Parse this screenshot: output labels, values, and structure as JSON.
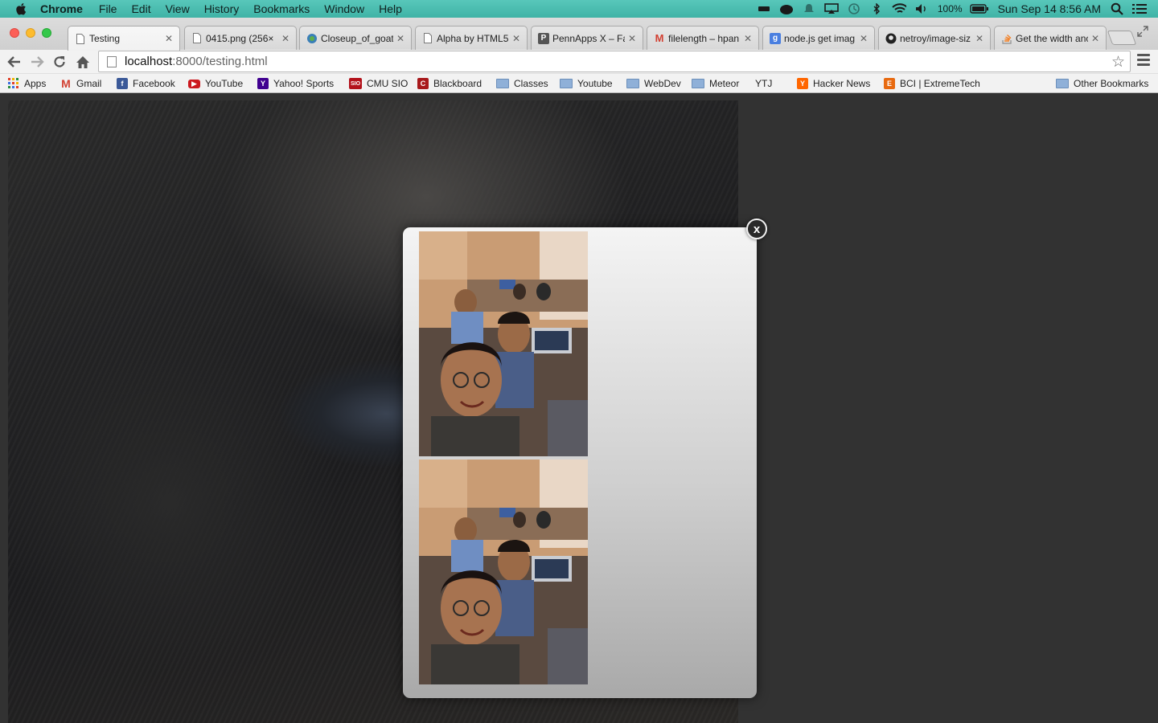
{
  "menubar": {
    "app": "Chrome",
    "items": [
      "File",
      "Edit",
      "View",
      "History",
      "Bookmarks",
      "Window",
      "Help"
    ],
    "battery": "100%",
    "datetime": "Sun Sep 14  8:56 AM"
  },
  "tabs": [
    {
      "title": "Testing",
      "favicon": "page-icon",
      "active": true
    },
    {
      "title": "0415.png (256×",
      "favicon": "page-icon"
    },
    {
      "title": "Closeup_of_goat",
      "favicon": "wikimedia-icon"
    },
    {
      "title": "Alpha by HTML5",
      "favicon": "page-icon"
    },
    {
      "title": "PennApps X – Fa",
      "favicon": "pennapps-icon"
    },
    {
      "title": "filelength – hpan",
      "favicon": "gmail-icon"
    },
    {
      "title": "node.js get imag",
      "favicon": "google-icon"
    },
    {
      "title": "netroy/image-siz",
      "favicon": "github-icon"
    },
    {
      "title": "Get the width anc",
      "favicon": "stackoverflow-icon"
    }
  ],
  "address": {
    "host": "localhost",
    "path": ":8000/testing.html"
  },
  "bookmarks": [
    {
      "label": "Apps",
      "icon": "apps-grid-icon"
    },
    {
      "label": "Gmail",
      "icon": "gmail-icon"
    },
    {
      "label": "Facebook",
      "icon": "facebook-icon"
    },
    {
      "label": "YouTube",
      "icon": "youtube-icon"
    },
    {
      "label": "Yahoo! Sports",
      "icon": "yahoo-icon"
    },
    {
      "label": "CMU SIO",
      "icon": "sio-icon"
    },
    {
      "label": "Blackboard",
      "icon": "blackboard-icon"
    },
    {
      "label": "Classes",
      "icon": "folder-icon"
    },
    {
      "label": "Youtube",
      "icon": "folder-icon"
    },
    {
      "label": "WebDev",
      "icon": "folder-icon"
    },
    {
      "label": "Meteor",
      "icon": "folder-icon"
    },
    {
      "label": "YTJ",
      "icon": "page-icon"
    },
    {
      "label": "Hacker News",
      "icon": "hackernews-icon"
    },
    {
      "label": "BCI | ExtremeTech",
      "icon": "extremetech-icon"
    },
    {
      "label": "Other Bookmarks",
      "icon": "folder-icon"
    }
  ],
  "modal": {
    "close_label": "x"
  },
  "colors": {
    "menubar": "#4fbfb2",
    "page_bg": "#323232",
    "modal_top": "#f4f4f4",
    "modal_bottom": "#a9a9a9"
  }
}
